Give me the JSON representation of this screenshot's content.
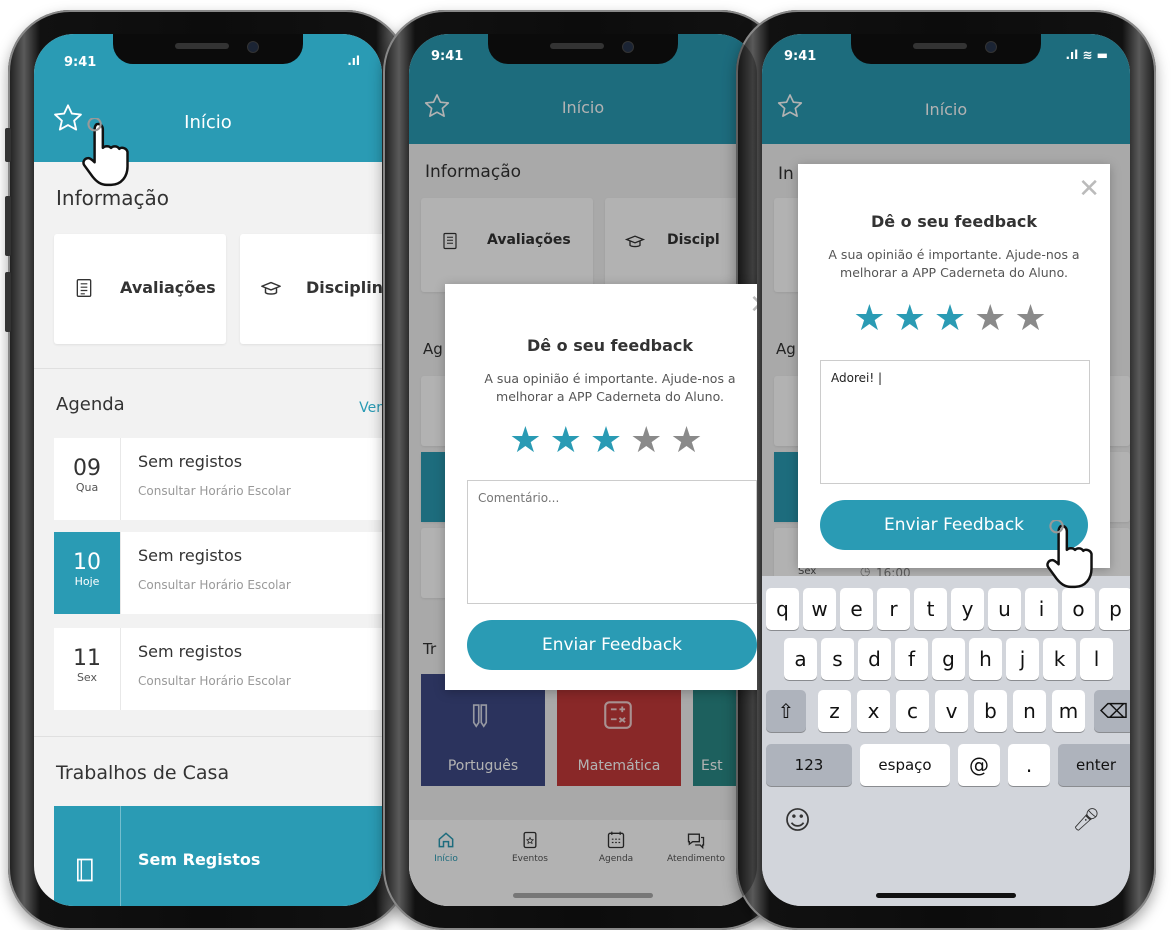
{
  "colors": {
    "accent": "#2a9bb4",
    "star_off": "#8a8a8a",
    "portugues": "#3e4a86",
    "matematica": "#c43a3a"
  },
  "status": {
    "time": "9:41"
  },
  "header": {
    "title": "Início"
  },
  "screen1": {
    "info_title": "Informação",
    "cards": [
      {
        "label": "Avaliações",
        "icon": "document-icon"
      },
      {
        "label": "Disciplin",
        "icon": "graduation-cap-icon"
      }
    ],
    "agenda_title": "Agenda",
    "agenda_link": "Ver",
    "agenda": [
      {
        "day": "09",
        "weekday": "Qua",
        "title": "Sem registos",
        "subtitle": "Consultar Horário Escolar",
        "today": false
      },
      {
        "day": "10",
        "weekday": "Hoje",
        "title": "Sem registos",
        "subtitle": "Consultar Horário Escolar",
        "today": true
      },
      {
        "day": "11",
        "weekday": "Sex",
        "title": "Sem registos",
        "subtitle": "Consultar Horário Escolar",
        "today": false
      }
    ],
    "homework_title": "Trabalhos de Casa",
    "homework_card": {
      "title": "Sem Registos"
    }
  },
  "screen2": {
    "info_title": "Informação",
    "cards": [
      {
        "label": "Avaliações"
      },
      {
        "label": "Discipl"
      }
    ],
    "agenda_title_partial": "Ag",
    "homework_title_partial": "Tr",
    "subjects": [
      {
        "label": "Português"
      },
      {
        "label": "Matemática"
      },
      {
        "label": "Est"
      }
    ],
    "modal": {
      "title": "Dê o seu feedback",
      "subtitle": "A sua opinião é importante. Ajude-nos a melhorar a APP Caderneta do Aluno.",
      "rating": 3,
      "max_rating": 5,
      "comment_placeholder": "Comentário...",
      "button": "Enviar Feedback"
    },
    "tabs": [
      {
        "label": "Início",
        "icon": "home-icon"
      },
      {
        "label": "Eventos",
        "icon": "events-icon"
      },
      {
        "label": "Agenda",
        "icon": "calendar-icon"
      },
      {
        "label": "Atendimento",
        "icon": "chat-icon"
      }
    ]
  },
  "screen3": {
    "info_title_partial": "In",
    "agenda_title_partial": "Ag",
    "agenda_link_partial": "ais",
    "bg_weekday": "Sex",
    "bg_time": "16:00",
    "modal": {
      "title": "Dê o seu feedback",
      "subtitle": "A sua opinião é importante. Ajude-nos a melhorar a APP Caderneta do Aluno.",
      "rating": 3,
      "max_rating": 5,
      "comment_value": "Adorei! |",
      "button": "Enviar Feedback"
    },
    "keyboard": {
      "row1": [
        "q",
        "w",
        "e",
        "r",
        "t",
        "y",
        "u",
        "i",
        "o",
        "p"
      ],
      "row2": [
        "a",
        "s",
        "d",
        "f",
        "g",
        "h",
        "j",
        "k",
        "l"
      ],
      "row3": [
        "z",
        "x",
        "c",
        "v",
        "b",
        "n",
        "m"
      ],
      "numbers_key": "123",
      "space_key": "espaço",
      "at_key": "@",
      "dot_key": ".",
      "enter_key": "enter"
    }
  }
}
